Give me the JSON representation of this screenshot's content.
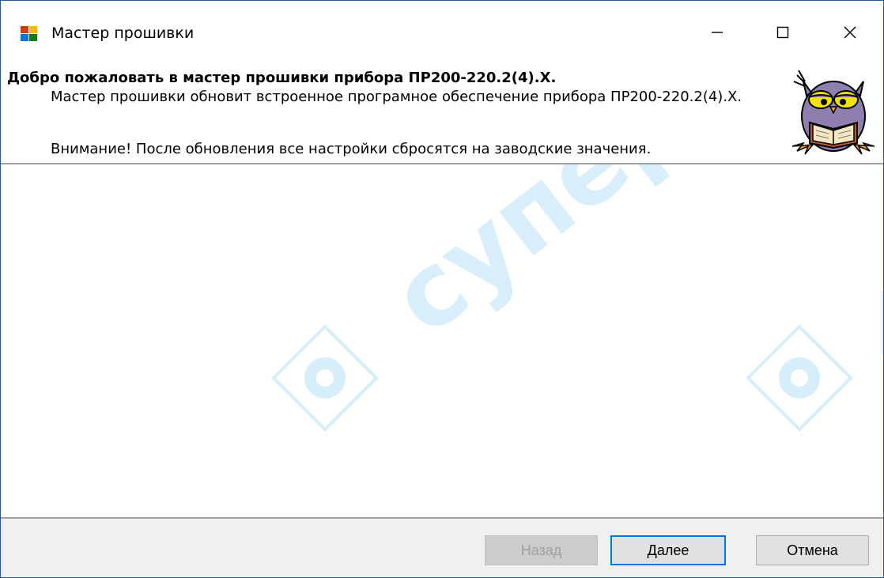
{
  "window": {
    "title": "Мастер прошивки",
    "controls": {
      "minimize_icon": "minimize-icon",
      "maximize_icon": "maximize-icon",
      "close_icon": "close-icon"
    }
  },
  "header": {
    "title": "Добро пожаловать в мастер прошивки прибора ПР200-220.2(4).Х.",
    "description": "Мастер прошивки обновит встроенное програмное обеспечение прибора ПР200-220.2(4).Х.",
    "warning": "Внимание! После обновления все настройки сбросятся на заводские значения.",
    "image": "owl-reading-book-icon"
  },
  "footer": {
    "back_label": "Назад",
    "next_label": "Далее",
    "cancel_label": "Отмена"
  },
  "watermark": {
    "text": "супероис",
    "color": "#d6eefa"
  },
  "colors": {
    "window_border": "#2b579a",
    "focus_border": "#0078d7",
    "footer_bg": "#f0f0f0",
    "button_bg": "#e1e1e1",
    "disabled_text": "#a0a0a0"
  }
}
